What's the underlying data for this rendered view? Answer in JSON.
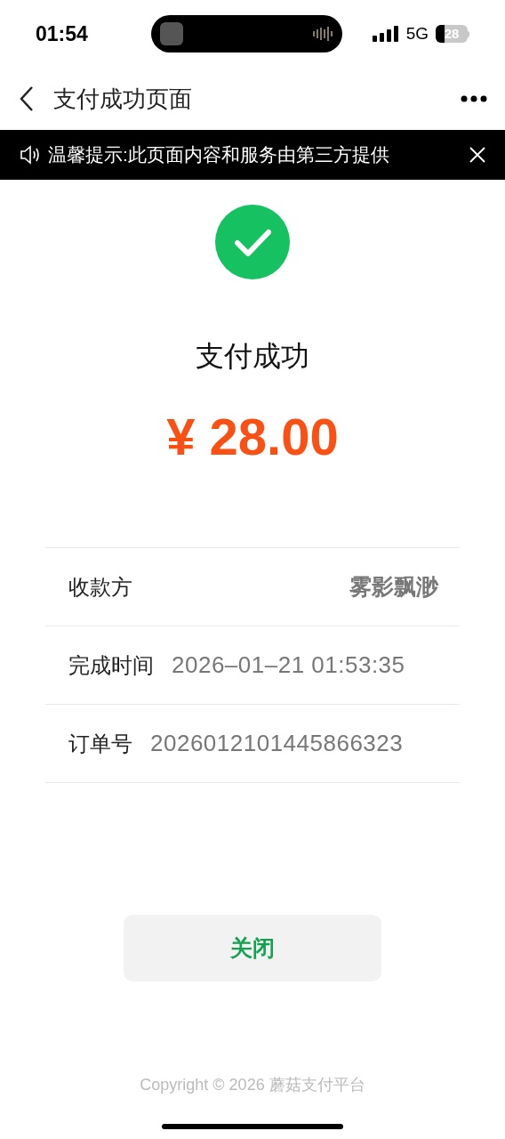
{
  "status_bar": {
    "time": "01:54",
    "network": "5G",
    "battery": "28"
  },
  "header": {
    "title": "支付成功页面"
  },
  "notice": {
    "text": "温馨提示:此页面内容和服务由第三方提供"
  },
  "result": {
    "title": "支付成功",
    "amount": "¥ 28.00"
  },
  "details": [
    {
      "kind": "split",
      "label": "收款方",
      "value": "雾影飘渺"
    },
    {
      "kind": "inline",
      "label": "完成时间",
      "value": "2026–01–21 01:53:35"
    },
    {
      "kind": "inline",
      "label": "订单号",
      "value": "2026012101445866323"
    }
  ],
  "close_button": "关闭",
  "footer": "Copyright © 2026 蘑菇支付平台"
}
